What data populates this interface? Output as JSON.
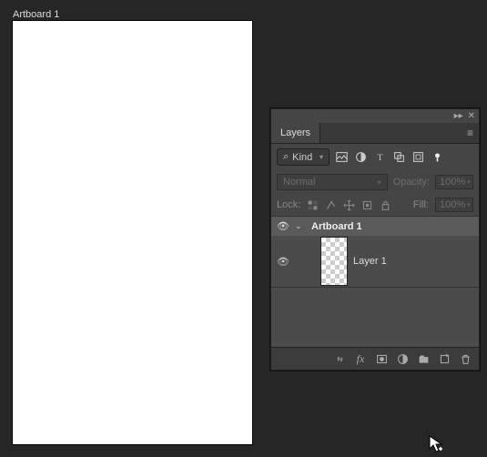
{
  "artboard": {
    "label": "Artboard 1"
  },
  "panel": {
    "title": "Layers",
    "kindLabel": "Kind",
    "blendMode": "Normal",
    "opacityLabel": "Opacity:",
    "opacityValue": "100%",
    "lockLabel": "Lock:",
    "fillLabel": "Fill:",
    "fillValue": "100%",
    "group": {
      "name": "Artboard 1"
    },
    "layer": {
      "name": "Layer 1"
    }
  }
}
